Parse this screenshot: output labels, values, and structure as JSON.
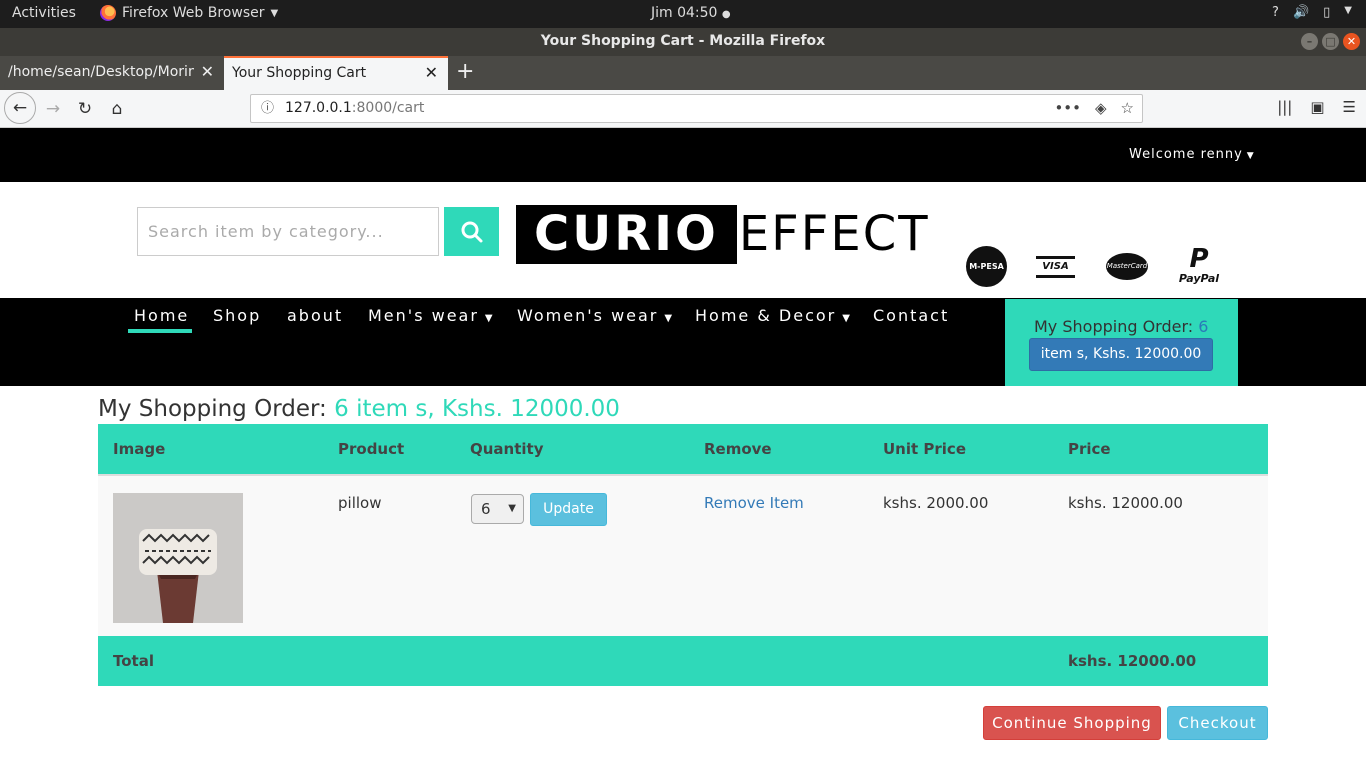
{
  "gnome": {
    "activities": "Activities",
    "app_menu": "Firefox Web Browser",
    "clock": "Jim 04:50"
  },
  "browser": {
    "window_title": "Your Shopping Cart - Mozilla Firefox",
    "tabs": [
      {
        "title": "/home/sean/Desktop/Moringa"
      },
      {
        "title": "Your Shopping Cart"
      }
    ],
    "url_host": "127.0.0.1",
    "url_path": ":8000/cart"
  },
  "site": {
    "welcome": "Welcome renny",
    "search_placeholder": "Search item by category...",
    "logo_black": "CURIO",
    "logo_white": "EFFECT",
    "payments": {
      "mpesa": "M-PESA",
      "visa": "VISA",
      "mastercard": "MasterCard",
      "paypal": "PayPal"
    },
    "nav": {
      "home": "Home",
      "shop": "Shop",
      "about": "about",
      "mens": "Men's wear",
      "womens": "Women's wear",
      "home_decor": "Home & Decor",
      "contact": "Contact"
    },
    "order_box": {
      "label": "My Shopping Order:",
      "count": "6",
      "button": "item s, Kshs. 12000.00"
    }
  },
  "cart": {
    "heading_prefix": "My Shopping Order:",
    "heading_summary": "6 item s, Kshs. 12000.00",
    "columns": {
      "image": "Image",
      "product": "Product",
      "quantity": "Quantity",
      "remove": "Remove",
      "unit_price": "Unit Price",
      "price": "Price"
    },
    "row": {
      "product": "pillow",
      "quantity": "6",
      "update": "Update",
      "remove": "Remove Item",
      "unit_price": "kshs. 2000.00",
      "price": "kshs. 12000.00"
    },
    "total_label": "Total",
    "total_value": "kshs. 12000.00",
    "continue_btn": "Continue Shopping",
    "checkout_btn": "Checkout"
  },
  "colors": {
    "accent": "#2fd9b9",
    "primary": "#337ab7",
    "info": "#5bc0de",
    "danger": "#d9534f"
  }
}
